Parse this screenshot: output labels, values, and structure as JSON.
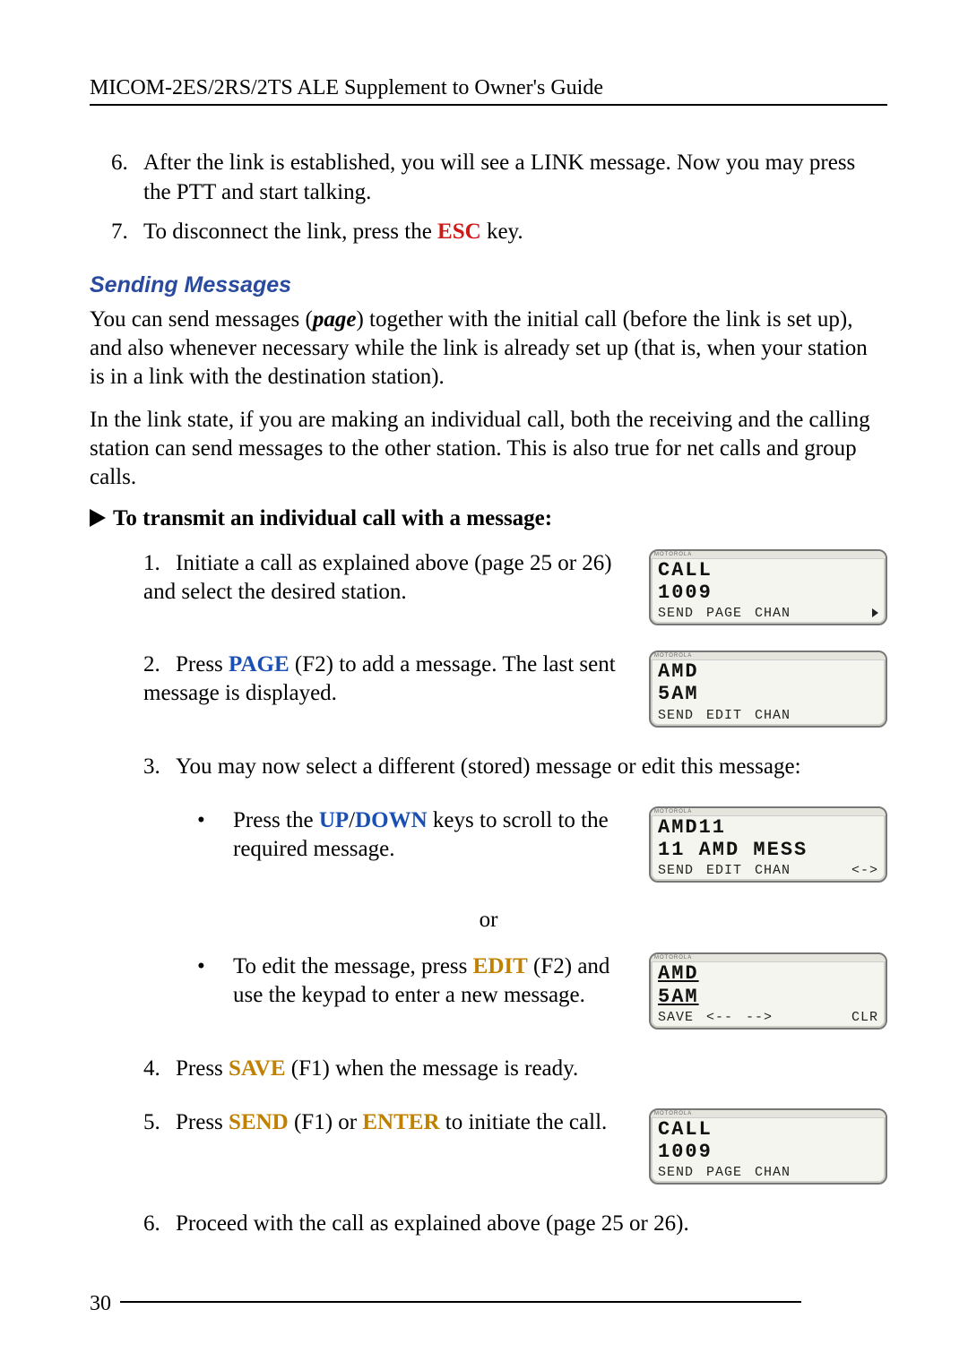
{
  "header": "MICOM-2ES/2RS/2TS ALE Supplement to Owner's Guide",
  "cont_list": {
    "item6_num": "6.",
    "item6": "After the link is established, you will see a LINK message. Now you may press the PTT and start talking.",
    "item7_num": "7.",
    "item7_pre": "To disconnect the link, press the ",
    "item7_key": "ESC",
    "item7_post": " key."
  },
  "subhead": "Sending Messages",
  "para1_a": "You can send messages (",
  "para1_em": "page",
  "para1_b": ") together with the initial call (before the link is set up), and also whenever necessary while the link is already set up (that is, when your station is in a link with the destination station).",
  "para2": "In the link state, if you are making an individual call, both the receiving and the calling station can send messages to the other station. This is also true for net calls and group calls.",
  "proc_title": "To transmit an individual call with a message:",
  "steps": {
    "s1_num": "1.",
    "s1": "Initiate a call as explained above (page 25 or 26) and select the desired station.",
    "s2_num": "2.",
    "s2_a": "Press ",
    "s2_key": "PAGE",
    "s2_b": " (F2) to add a message. The last sent message is displayed.",
    "s3_num": "3.",
    "s3": "You may now select a different (stored) message or edit this message:",
    "b1_a": "Press the ",
    "b1_up": "UP",
    "b1_slash": "/",
    "b1_down": "DOWN",
    "b1_b": " keys to scroll to the required message.",
    "or": "or",
    "b2_a": "To edit the message, press ",
    "b2_key": "EDIT",
    "b2_b": " (F2) and use the keypad to enter a new message.",
    "s4_num": "4.",
    "s4_a": "Press ",
    "s4_key": "SAVE",
    "s4_b": " (F1) when the message is ready.",
    "s5_num": "5.",
    "s5_a": "Press ",
    "s5_key1": "SEND",
    "s5_mid": " (F1) or ",
    "s5_key2": "ENTER",
    "s5_b": " to initiate the call.",
    "s6_num": "6.",
    "s6": "Proceed with the call as explained above (page 25 or 26)."
  },
  "lcd_brand": "MOTOROLA",
  "lcd1": {
    "l1": "CALL",
    "l2": "1009",
    "s1": "SEND",
    "s2": "PAGE",
    "s3": "CHAN",
    "more": "▶"
  },
  "lcd2": {
    "l1": "AMD",
    "l2": "5AM",
    "s1": "SEND",
    "s2": "EDIT",
    "s3": "CHAN"
  },
  "lcd3": {
    "l1": "AMD11",
    "l2": "11 AMD MESS",
    "s1": "SEND",
    "s2": "EDIT",
    "s3": "CHAN",
    "s4": "<->"
  },
  "lcd4": {
    "l1": "AMD",
    "l2": "5AM",
    "s1": "SAVE",
    "s2": "<--",
    "s3": "-->",
    "s4": "CLR"
  },
  "lcd5": {
    "l1": "CALL",
    "l2": "1009",
    "s1": "SEND",
    "s2": "PAGE",
    "s3": "CHAN"
  },
  "page_number": "30"
}
